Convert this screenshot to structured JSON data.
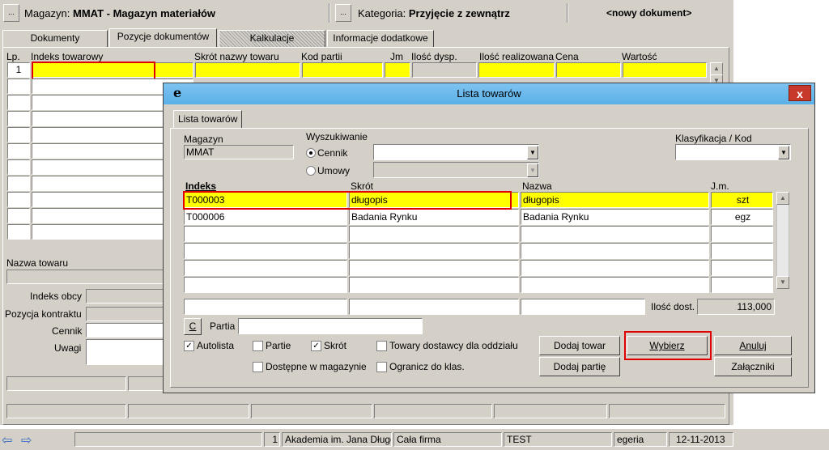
{
  "header": {
    "magazyn_label": "Magazyn:",
    "magazyn_value": "MMAT - Magazyn materiałów",
    "kategoria_label": "Kategoria:",
    "kategoria_value": "Przyjęcie z zewnątrz",
    "doc_status": "<nowy dokument>",
    "small_btn": "..."
  },
  "tabs": [
    {
      "label": "Dokumenty"
    },
    {
      "label": "Pozycje dokumentów"
    },
    {
      "label": "Kalkulacje"
    },
    {
      "label": "Informacje dodatkowe"
    }
  ],
  "grid": {
    "columns": [
      "Lp.",
      "Indeks towarowy",
      "Skrót nazwy towaru",
      "Kod partii",
      "Jm",
      "Ilość dysp.",
      "Ilość realizowana",
      "Cena",
      "Wartość"
    ],
    "first_row_lp": "1"
  },
  "left_form": {
    "nazwa_towaru": "Nazwa towaru",
    "indeks_obcy": "Indeks obcy",
    "pozycja_kontraktu": "Pozycja kontraktu",
    "cennik": "Cennik",
    "uwagi": "Uwagi"
  },
  "statusbar": {
    "num": "1",
    "org": "Akademia im. Jana Długosza",
    "scope": "Cała firma",
    "env": "TEST",
    "user": "egeria",
    "date": "12-11-2013"
  },
  "dialog": {
    "title": "Lista towarów",
    "logo": "e",
    "close": "x",
    "tab": "Lista towarów",
    "magazyn_label": "Magazyn",
    "magazyn_value": "MMAT",
    "wyszukiwanie_label": "Wyszukiwanie",
    "radio_cennik": "Cennik",
    "radio_umowy": "Umowy",
    "klasyfikacja_label": "Klasyfikacja / Kod",
    "columns": {
      "indeks": "Indeks",
      "skrot": "Skrót",
      "nazwa": "Nazwa",
      "jm": "J.m."
    },
    "rows": [
      {
        "indeks": "T000003",
        "skrot": "długopis",
        "nazwa": "długopis",
        "jm": "szt"
      },
      {
        "indeks": "T000006",
        "skrot": "Badania Rynku",
        "nazwa": "Badania Rynku",
        "jm": "egz"
      }
    ],
    "ilosc_dost_label": "Ilość dost.",
    "ilosc_dost_value": "113,000",
    "c_btn": "C",
    "partia_label": "Partia",
    "checkboxes": {
      "autolista": "Autolista",
      "partie": "Partie",
      "skrot": "Skrót",
      "towary_dostawcy": "Towary dostawcy dla oddziału",
      "dostepne": "Dostępne w magazynie",
      "ogranicz": "Ogranicz do klas."
    },
    "buttons": {
      "dodaj_towar": "Dodaj towar",
      "dodaj_partie": "Dodaj partię",
      "wybierz": "Wybierz",
      "anuluj": "Anuluj",
      "zalaczniki": "Załączniki"
    }
  }
}
